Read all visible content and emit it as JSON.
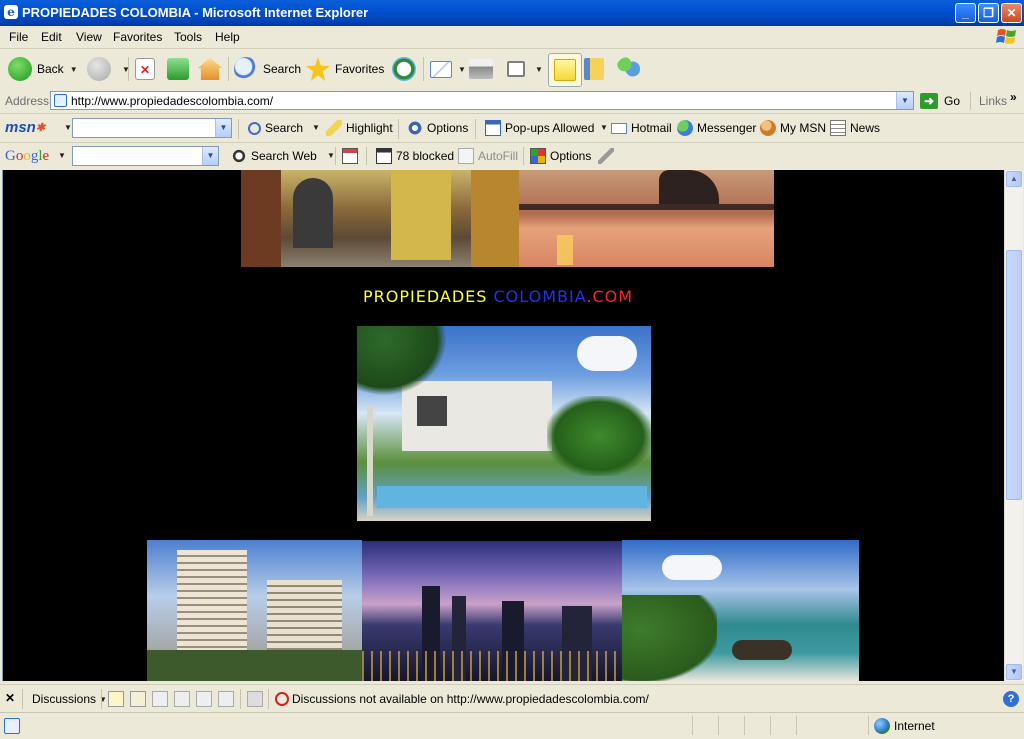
{
  "window": {
    "title": "PROPIEDADES COLOMBIA - Microsoft Internet Explorer",
    "minimize": "_",
    "maximize": "❐",
    "close": "✕"
  },
  "menu": [
    "File",
    "Edit",
    "View",
    "Favorites",
    "Tools",
    "Help"
  ],
  "toolbar": {
    "back": "Back",
    "search": "Search",
    "favorites": "Favorites"
  },
  "address": {
    "label": "Address",
    "url": "http://www.propiedadescolombia.com/",
    "go": "Go",
    "links": "Links",
    "more": "»"
  },
  "msn": {
    "logo": "msn",
    "search": "Search",
    "highlight": "Highlight",
    "options": "Options",
    "popups": "Pop-ups Allowed",
    "hotmail": "Hotmail",
    "messenger": "Messenger",
    "mymsn": "My MSN",
    "news": "News"
  },
  "google": {
    "logo": "Google",
    "search_web": "Search Web",
    "blocked": "78 blocked",
    "autofill": "AutoFill",
    "options": "Options"
  },
  "page": {
    "title_part1": "PROPIEDADES",
    "title_part2": "COLOMBIA",
    "title_part3": ".COM",
    "title_colors": {
      "part1": "#ffff33",
      "part2": "#2233ee",
      "part3": "#ff2222"
    }
  },
  "discussions": {
    "close": "✕",
    "label": "Discussions",
    "message": "Discussions not available on http://www.propiedadescolombia.com/"
  },
  "status": {
    "zone": "Internet"
  },
  "icons": [
    "ie-page-icon",
    "back-icon",
    "forward-icon",
    "stop-icon",
    "refresh-icon",
    "home-icon",
    "search-icon",
    "favorites-star-icon",
    "history-icon",
    "mail-icon",
    "print-icon",
    "edit-icon",
    "notes-icon",
    "research-icon",
    "messenger-icon",
    "go-arrow-icon",
    "highlight-icon",
    "popup-icon",
    "globe-icon",
    "help-icon"
  ]
}
